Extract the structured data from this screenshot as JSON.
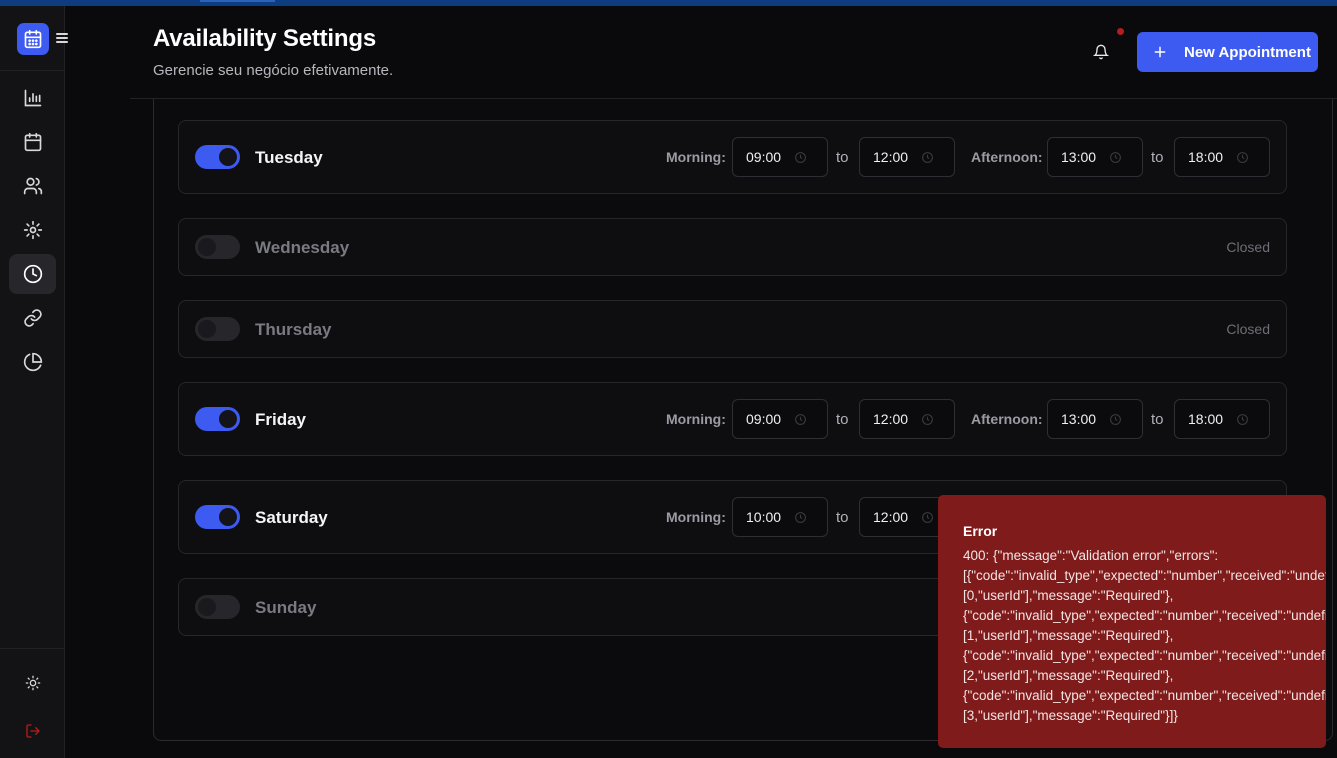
{
  "header": {
    "title": "Availability Settings",
    "subtitle": "Gerencie seu negócio efetivamente.",
    "new_appointment_label": "New Appointment"
  },
  "sidebar": {
    "items": [
      {
        "icon": "bar-chart-icon"
      },
      {
        "icon": "calendar-icon"
      },
      {
        "icon": "users-icon"
      },
      {
        "icon": "gear-icon"
      },
      {
        "icon": "clock-icon",
        "active": true
      },
      {
        "icon": "link-icon"
      },
      {
        "icon": "pie-chart-icon"
      }
    ],
    "bottom": [
      {
        "icon": "sun-icon"
      },
      {
        "icon": "logout-icon"
      }
    ]
  },
  "schedule": {
    "morning_label": "Morning:",
    "afternoon_label": "Afternoon:",
    "to_label": "to",
    "closed_label": "Closed",
    "days": [
      {
        "name": "Tuesday",
        "enabled": true,
        "morning_start": "09:00",
        "morning_end": "12:00",
        "afternoon_start": "13:00",
        "afternoon_end": "18:00"
      },
      {
        "name": "Wednesday",
        "enabled": false
      },
      {
        "name": "Thursday",
        "enabled": false
      },
      {
        "name": "Friday",
        "enabled": true,
        "morning_start": "09:00",
        "morning_end": "12:00",
        "afternoon_start": "13:00",
        "afternoon_end": "18:00"
      },
      {
        "name": "Saturday",
        "enabled": true,
        "morning_start": "10:00",
        "morning_end": "12:00"
      },
      {
        "name": "Sunday",
        "enabled": false
      }
    ]
  },
  "toast": {
    "title": "Error",
    "lines": [
      "400: {\"message\":\"Validation error\",\"errors\":",
      "[{\"code\":\"invalid_type\",\"expected\":\"number\",\"received\":\"undefined\",\"path\":",
      "[0,\"userId\"],\"message\":\"Required\"},",
      "{\"code\":\"invalid_type\",\"expected\":\"number\",\"received\":\"undefined\",\"path\":",
      "[1,\"userId\"],\"message\":\"Required\"},",
      "{\"code\":\"invalid_type\",\"expected\":\"number\",\"received\":\"undefined\",\"path\":",
      "[2,\"userId\"],\"message\":\"Required\"},",
      "{\"code\":\"invalid_type\",\"expected\":\"number\",\"received\":\"undefined\",\"path\":",
      "[3,\"userId\"],\"message\":\"Required\"}]}"
    ]
  },
  "colors": {
    "accent": "#3d5af1",
    "error_bg": "#7f1b1b",
    "notification_dot": "#b91c1c",
    "logout": "#b91c1c"
  }
}
